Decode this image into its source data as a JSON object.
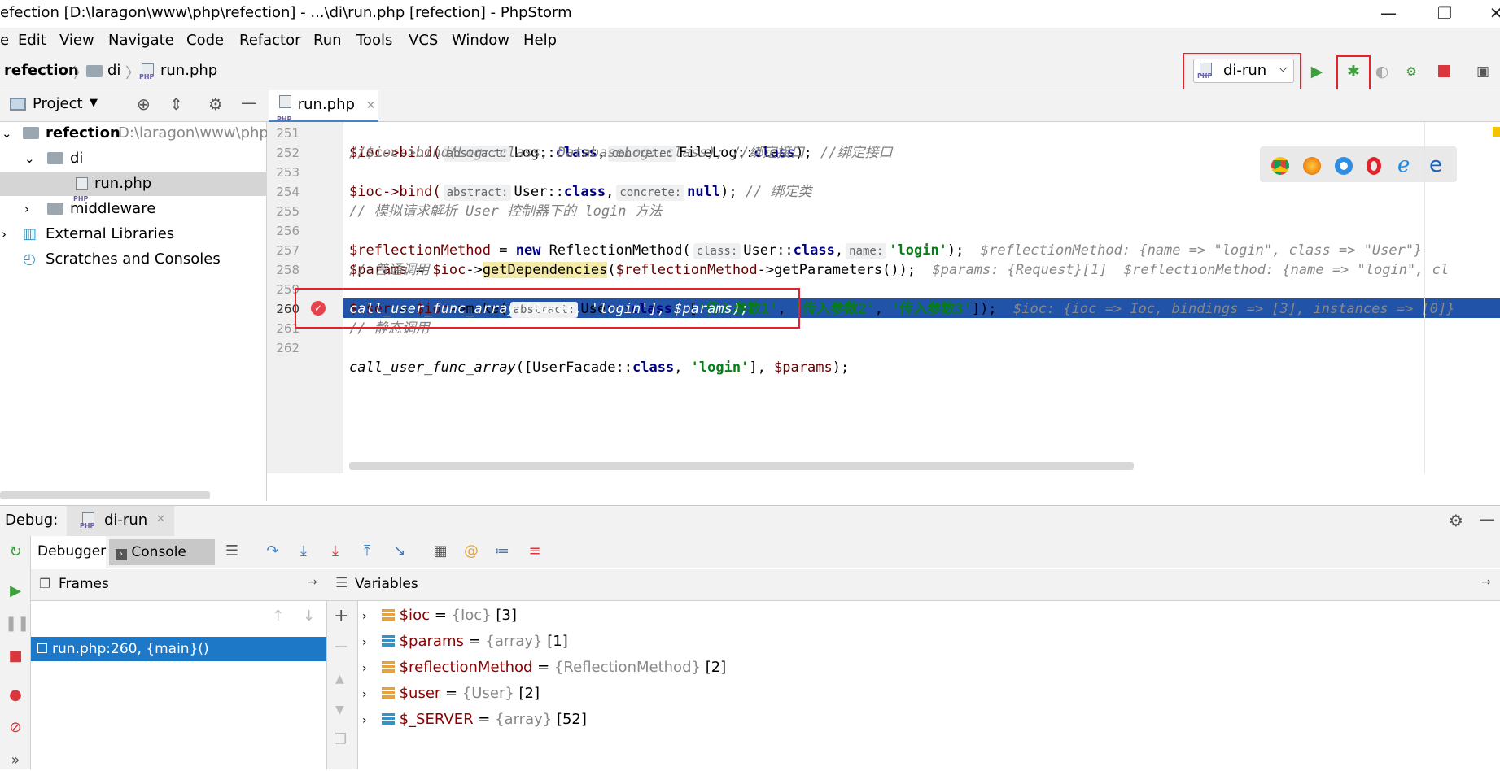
{
  "window": {
    "title": "efection [D:\\laragon\\www\\php\\refection] - ...\\di\\run.php [refection] - PhpStorm",
    "minimize": "—",
    "restore": "❐",
    "close": "✕"
  },
  "menu": [
    "e",
    "Edit",
    "View",
    "Navigate",
    "Code",
    "Refactor",
    "Run",
    "Tools",
    "VCS",
    "Window",
    "Help"
  ],
  "breadcrumb": {
    "project": "refection",
    "folder": "di",
    "file": "run.php"
  },
  "run_config": {
    "name": "di-run"
  },
  "project": {
    "title": "Project",
    "root": {
      "name": "refection",
      "path": "D:\\laragon\\www\\php"
    },
    "items": [
      "di",
      "run.php",
      "middleware",
      "External Libraries",
      "Scratches and Consoles"
    ]
  },
  "editor": {
    "tab": "run.php",
    "line_numbers": [
      "251",
      "252",
      "253",
      "254",
      "255",
      "256",
      "257",
      "258",
      "259",
      "260",
      "261",
      "262"
    ],
    "hints": {
      "abstract": "abstract:",
      "concrete": "concrete:",
      "class": "class:",
      "name": "name:"
    },
    "lines": {
      "l251a": "$ioc->bind(",
      "l251b": "Log::",
      "l251c": "class",
      ",": ",",
      "l251d": "FileLog::",
      "l251e": "class",
      "l251f": "); ",
      "l251g": "//绑定接口",
      "l252": "//$ioc->bind(Log::class, DatabaseLog::class); //绑定接口",
      "l253a": "$ioc->bind(",
      "l253b": "User::",
      "l253c": "class",
      "l253d": "null",
      "l253e": "); ",
      "l253f": "// 绑定类",
      "l255": "// 模拟请求解析 User 控制器下的 login 方法",
      "l256a": "$reflectionMethod",
      "l256b": " = ",
      "l256c": "new",
      " l256d": " ReflectionMethod(",
      "l256e": "User::",
      "l256f": "class",
      "l256g": "'login'",
      "l256h": ");",
      "l256i": "$reflectionMethod: {name => \"login\", class => \"User\"}",
      "l257a": "$params",
      "l257b": " = ",
      "l257c": "$ioc",
      "l257d": "->",
      "l257e": "getDependencies",
      "l257f": "(",
      "l257g": "$reflectionMethod",
      "l257h": "->getParameters());",
      "l257i": "$params: {Request}[1]  $reflectionMethod: {name => \"login\", cl",
      "l258": "// 普通调用",
      "l259a": "$user",
      "l259b": " = ",
      "l259c": "$ioc",
      "l259d": "->make(",
      "l259e": "User::",
      "l259f": "class",
      ", [": ", [",
      "l259g": "'传入参数1'",
      "l259h": "'传入参数2'",
      "l259i": "'传入参数3'",
      "l259j": "]);",
      "l259k": "$ioc: {ioc => Ioc, bindings => [3], instances => [0]}",
      "l260": "call_user_func_array([$user, 'login'], $params);",
      "l261": "// 静态调用",
      "l262a": "call_user_func_array",
      "l262b": "([UserFacade::",
      "l262c": "class",
      "l262d": ", ",
      "l262e": "'login'",
      "l262f": "], ",
      "l262g": "$params",
      "l262h": ");"
    }
  },
  "debug": {
    "label": "Debug:",
    "session": "di-run",
    "tabs": {
      "debugger": "Debugger",
      "console": "Console"
    },
    "frames_title": "Frames",
    "frame": "run.php:260, {main}()",
    "variables_title": "Variables",
    "variables": [
      {
        "name": "$ioc",
        "type": "{Ioc}",
        "count": "[3]"
      },
      {
        "name": "$params",
        "type": "{array}",
        "count": "[1]"
      },
      {
        "name": "$reflectionMethod",
        "type": "{ReflectionMethod}",
        "count": "[2]"
      },
      {
        "name": "$user",
        "type": "{User}",
        "count": "[2]"
      },
      {
        "name": "$_SERVER",
        "type": "{array}",
        "count": "[52]"
      }
    ]
  },
  "colors": {
    "accent": "#2154a8",
    "highlight": "#e0242c",
    "selection": "#1e78c8"
  }
}
